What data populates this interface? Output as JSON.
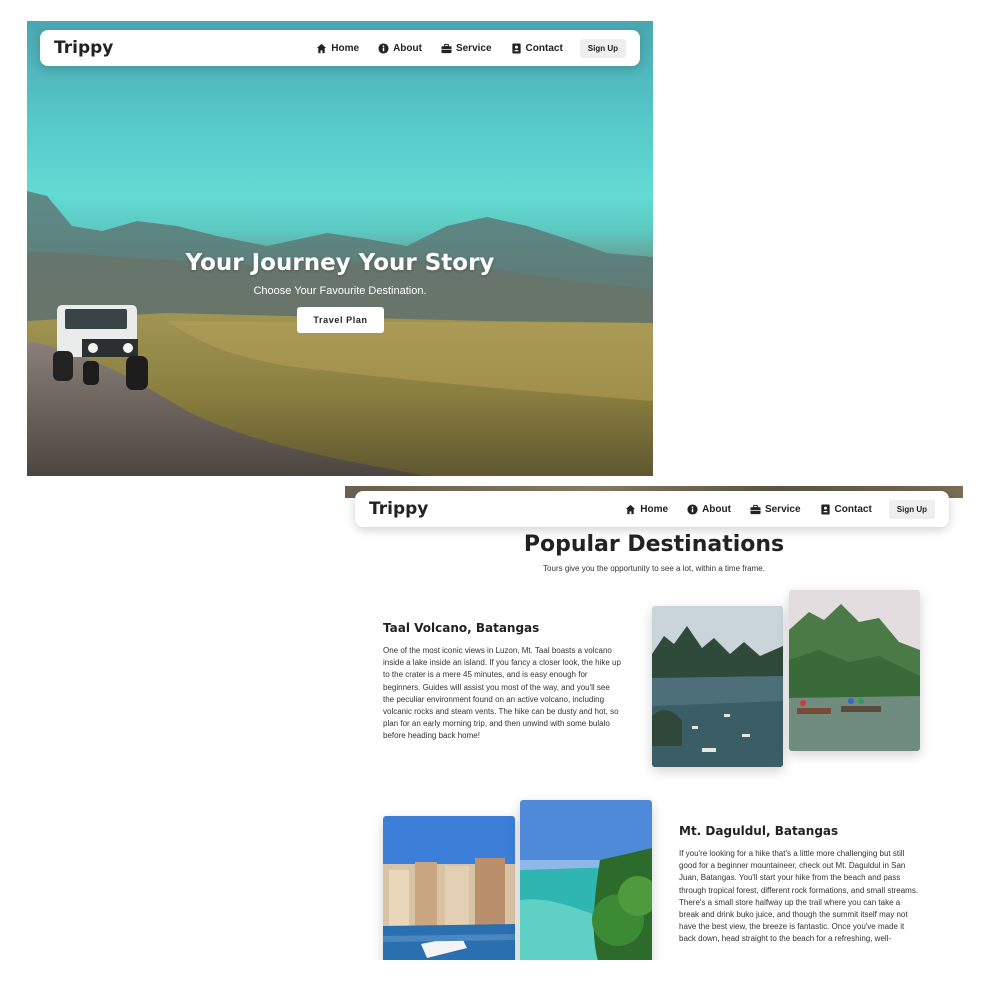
{
  "hero": {
    "brand": "Trippy",
    "nav": [
      {
        "label": "Home",
        "icon": "home-icon"
      },
      {
        "label": "About",
        "icon": "info-icon"
      },
      {
        "label": "Service",
        "icon": "briefcase-icon"
      },
      {
        "label": "Contact",
        "icon": "contact-book-icon"
      }
    ],
    "signup_label": "Sign Up",
    "title": "Your Journey Your Story",
    "subtitle": "Choose Your Favourite Destination.",
    "cta_label": "Travel Plan"
  },
  "destinations": {
    "brand": "Trippy",
    "nav": [
      {
        "label": "Home",
        "icon": "home-icon"
      },
      {
        "label": "About",
        "icon": "info-icon"
      },
      {
        "label": "Service",
        "icon": "briefcase-icon"
      },
      {
        "label": "Contact",
        "icon": "contact-book-icon"
      }
    ],
    "signup_label": "Sign Up",
    "heading": "Popular Destinations",
    "subheading": "Tours give you the opportunity to see a lot, within a time frame.",
    "items": [
      {
        "title": "Taal Volcano, Batangas",
        "text": "One of the most iconic views in Luzon, Mt. Taal boasts a volcano inside a lake inside an island. If you fancy a closer look, the hike up to the crater is a mere 45 minutes, and is easy enough for beginners. Guides will assist you most of the way, and you'll see the peculiar environment found on an active volcano, including volcanic rocks and steam vents. The hike can be dusty and hot, so plan for an early morning trip, and then unwind with some bulalo before heading back home!"
      },
      {
        "title": "Mt. Daguldul, Batangas",
        "text": "If you're looking for a hike that's a little more challenging but still good for a beginner mountaineer, check out Mt. Daguldul in San Juan, Batangas. You'll start your hike from the beach and pass through tropical forest, different rock formations, and small streams. There's a small store halfway up the trail where you can take a break and drink buko juice, and though the summit itself may not have the best view, the breeze is fantastic. Once you've made it back down, head straight to the beach for a refreshing, well-"
      }
    ]
  }
}
